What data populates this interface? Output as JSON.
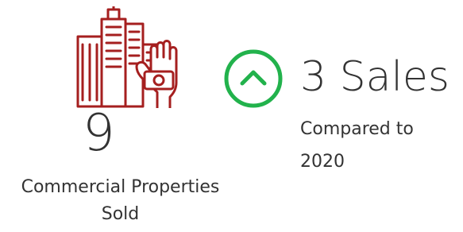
{
  "left_stat": {
    "icon": "buildings-hand-money-icon",
    "value": "9",
    "caption_line1": "Commercial Properties",
    "caption_line2": "Sold",
    "icon_color": "#a51f1f"
  },
  "right_stat": {
    "icon": "chevron-up-circle-icon",
    "value": "3 Sales",
    "compare_line1": "Compared to",
    "compare_line2": "2020",
    "icon_color": "#22b24c"
  }
}
